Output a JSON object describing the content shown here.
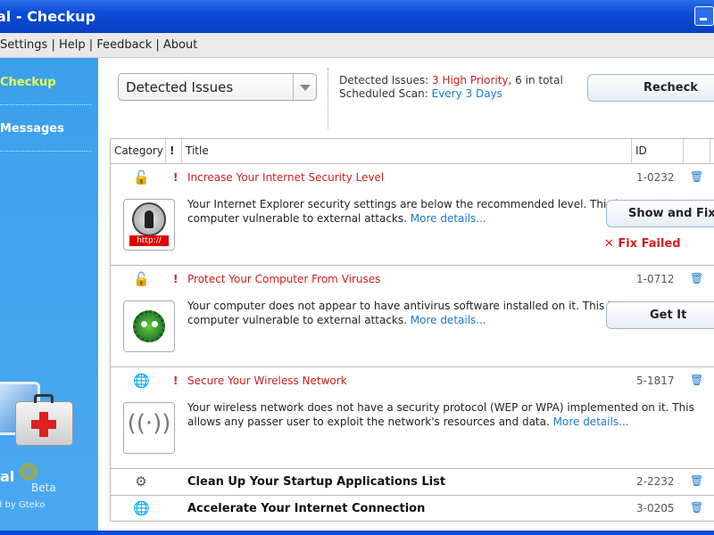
{
  "window": {
    "title": "al - Checkup"
  },
  "menu": {
    "items": [
      "Settings",
      "Help",
      "Feedback",
      "About"
    ],
    "sep": "|"
  },
  "sidebar": {
    "items": [
      {
        "label": "Checkup",
        "active": true
      },
      {
        "label": "Messages"
      }
    ],
    "brand": "al",
    "beta": "Beta",
    "by": "d by Gteko"
  },
  "header": {
    "dropdown": "Detected Issues",
    "detected_label": "Detected Issues: ",
    "detected_high": "3 High Priority",
    "detected_rest": ", 6 in total",
    "scan_label": "Scheduled Scan: ",
    "scan_value": "Every 3 Days",
    "recheck": "Recheck"
  },
  "table": {
    "columns": [
      "Category",
      "!",
      "Title",
      "ID"
    ],
    "rows": [
      {
        "icon": "lock-icon",
        "priority": "!",
        "title": "Increase Your Internet Security Level",
        "id": "1-0232",
        "desc": "Your Internet Explorer security settings are below the recommended level. This leaves your computer vulnerable to external attacks. ",
        "more": "More details...",
        "action": "Show and Fix",
        "status": "Fix Failed",
        "thumb_text": "http://"
      },
      {
        "icon": "lock-icon",
        "priority": "!",
        "title": "Protect Your Computer From Viruses",
        "id": "1-0712",
        "desc": "Your computer does not appear to have antivirus software installed on it. This leaves your computer vulnerable to external attacks. ",
        "more": "More details...",
        "action": "Get It"
      },
      {
        "icon": "globe-icon",
        "priority": "!",
        "title": "Secure Your Wireless Network",
        "id": "5-1817",
        "desc": "Your wireless network does not have a security protocol (WEP or WPA) implemented on it. This allows any passer user to exploit the network's resources and data. ",
        "more": "More details..."
      },
      {
        "icon": "gear-icon",
        "title": "Clean Up Your Startup Applications List",
        "id": "2-2232"
      },
      {
        "icon": "globe-icon",
        "title": "Accelerate Your Internet Connection",
        "id": "3-0205"
      }
    ]
  },
  "colors": {
    "accent": "#1a7bd0",
    "danger": "#d02020",
    "sidebar": "#3ba0ec",
    "titlebar": "#0a4bd6"
  }
}
